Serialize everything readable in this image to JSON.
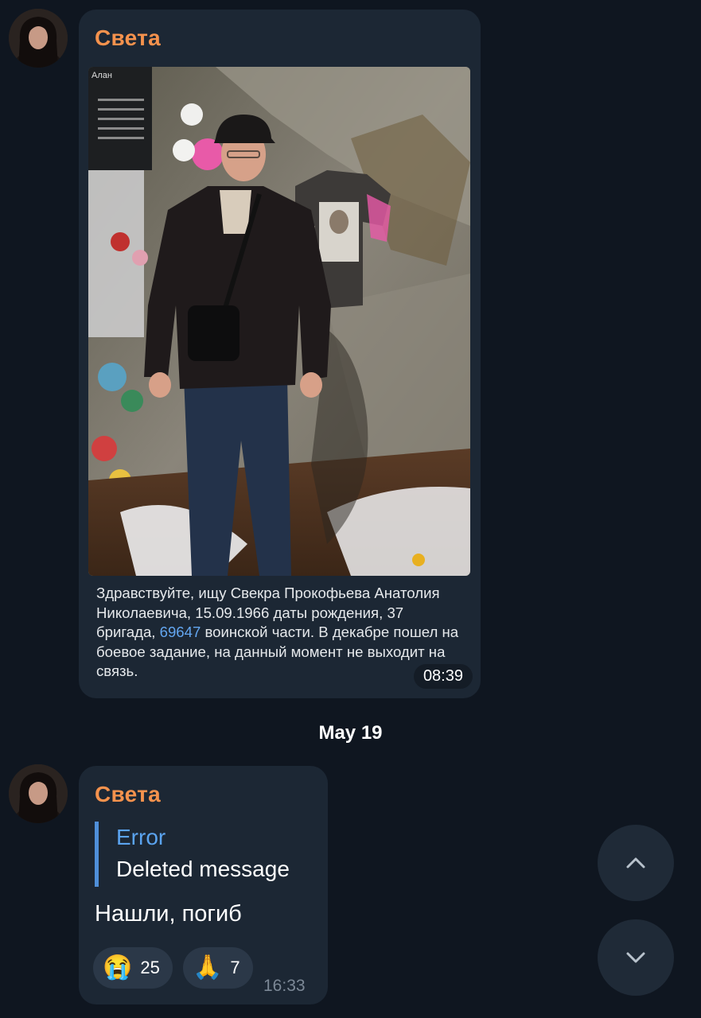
{
  "messages": [
    {
      "sender": "Света",
      "caption_parts": {
        "before_link": "Здравствуйте, ищу Свекра Прокофьева Анатолия Николаевича, 15.09.1966 даты рождения, 37 бригада, ",
        "link": "69647",
        "after_link": " воинской части. В декабре пошел на боевое задание, на данный момент не выходит на связь."
      },
      "photo_sign_text": "Алан",
      "time": "08:39"
    },
    {
      "sender": "Света",
      "reply": {
        "title": "Error",
        "text": "Deleted message"
      },
      "text": "Нашли, погиб",
      "reactions": [
        {
          "emoji": "😭",
          "count": "25"
        },
        {
          "emoji": "🙏",
          "count": "7"
        }
      ],
      "time": "16:33"
    }
  ],
  "date_separator": "May 19",
  "scroll_buttons": {
    "up_icon": "chevron-up-icon",
    "down_icon": "chevron-down-icon"
  },
  "colors": {
    "background": "#0f1620",
    "bubble": "#1c2734",
    "sender_name": "#f5924d",
    "link": "#63a6f0",
    "reply_accent": "#4f8fd9"
  }
}
